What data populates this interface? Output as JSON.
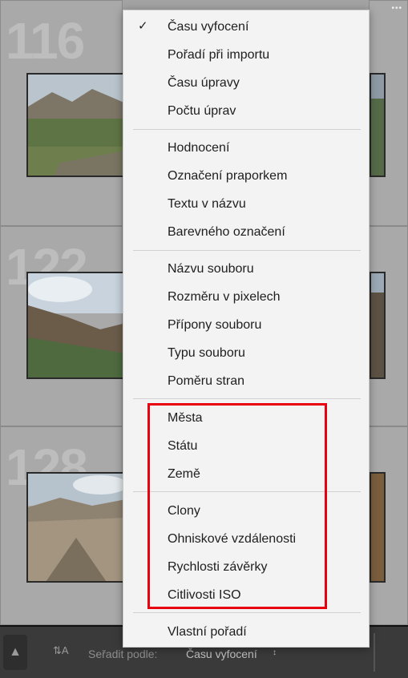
{
  "grid": {
    "cells": [
      {
        "number": "116"
      },
      {
        "number": "122"
      },
      {
        "number": "128"
      }
    ],
    "dots": "•••"
  },
  "menu": {
    "items": [
      {
        "label": "Času vyfocení",
        "checked": true
      },
      {
        "label": "Pořadí při importu"
      },
      {
        "label": "Času úpravy"
      },
      {
        "label": "Počtu úprav"
      },
      {
        "label": "Hodnocení"
      },
      {
        "label": "Označení praporkem"
      },
      {
        "label": "Textu v názvu"
      },
      {
        "label": "Barevného označení"
      },
      {
        "label": "Názvu souboru"
      },
      {
        "label": "Rozměru v pixelech"
      },
      {
        "label": "Přípony souboru"
      },
      {
        "label": "Typu souboru"
      },
      {
        "label": "Poměru stran"
      },
      {
        "label": "Města"
      },
      {
        "label": "Státu"
      },
      {
        "label": "Země"
      },
      {
        "label": "Clony"
      },
      {
        "label": "Ohniskové vzdálenosti"
      },
      {
        "label": "Rychlosti závěrky"
      },
      {
        "label": "Citlivosti ISO"
      },
      {
        "label": "Vlastní pořadí"
      }
    ],
    "check_glyph": "✓"
  },
  "toolbar": {
    "sort_label": "Seřadit podle:",
    "sort_value": "Času vyfocení",
    "sort_arrow": "↕",
    "sort_icon": "sort-az-icon",
    "left_icon": "spray-can-icon"
  },
  "colors": {
    "highlight": "#e8000f",
    "menu_bg": "#f3f3f3",
    "grid_bg": "#a3a3a3",
    "toolbar_bg": "#3a3a3a"
  }
}
